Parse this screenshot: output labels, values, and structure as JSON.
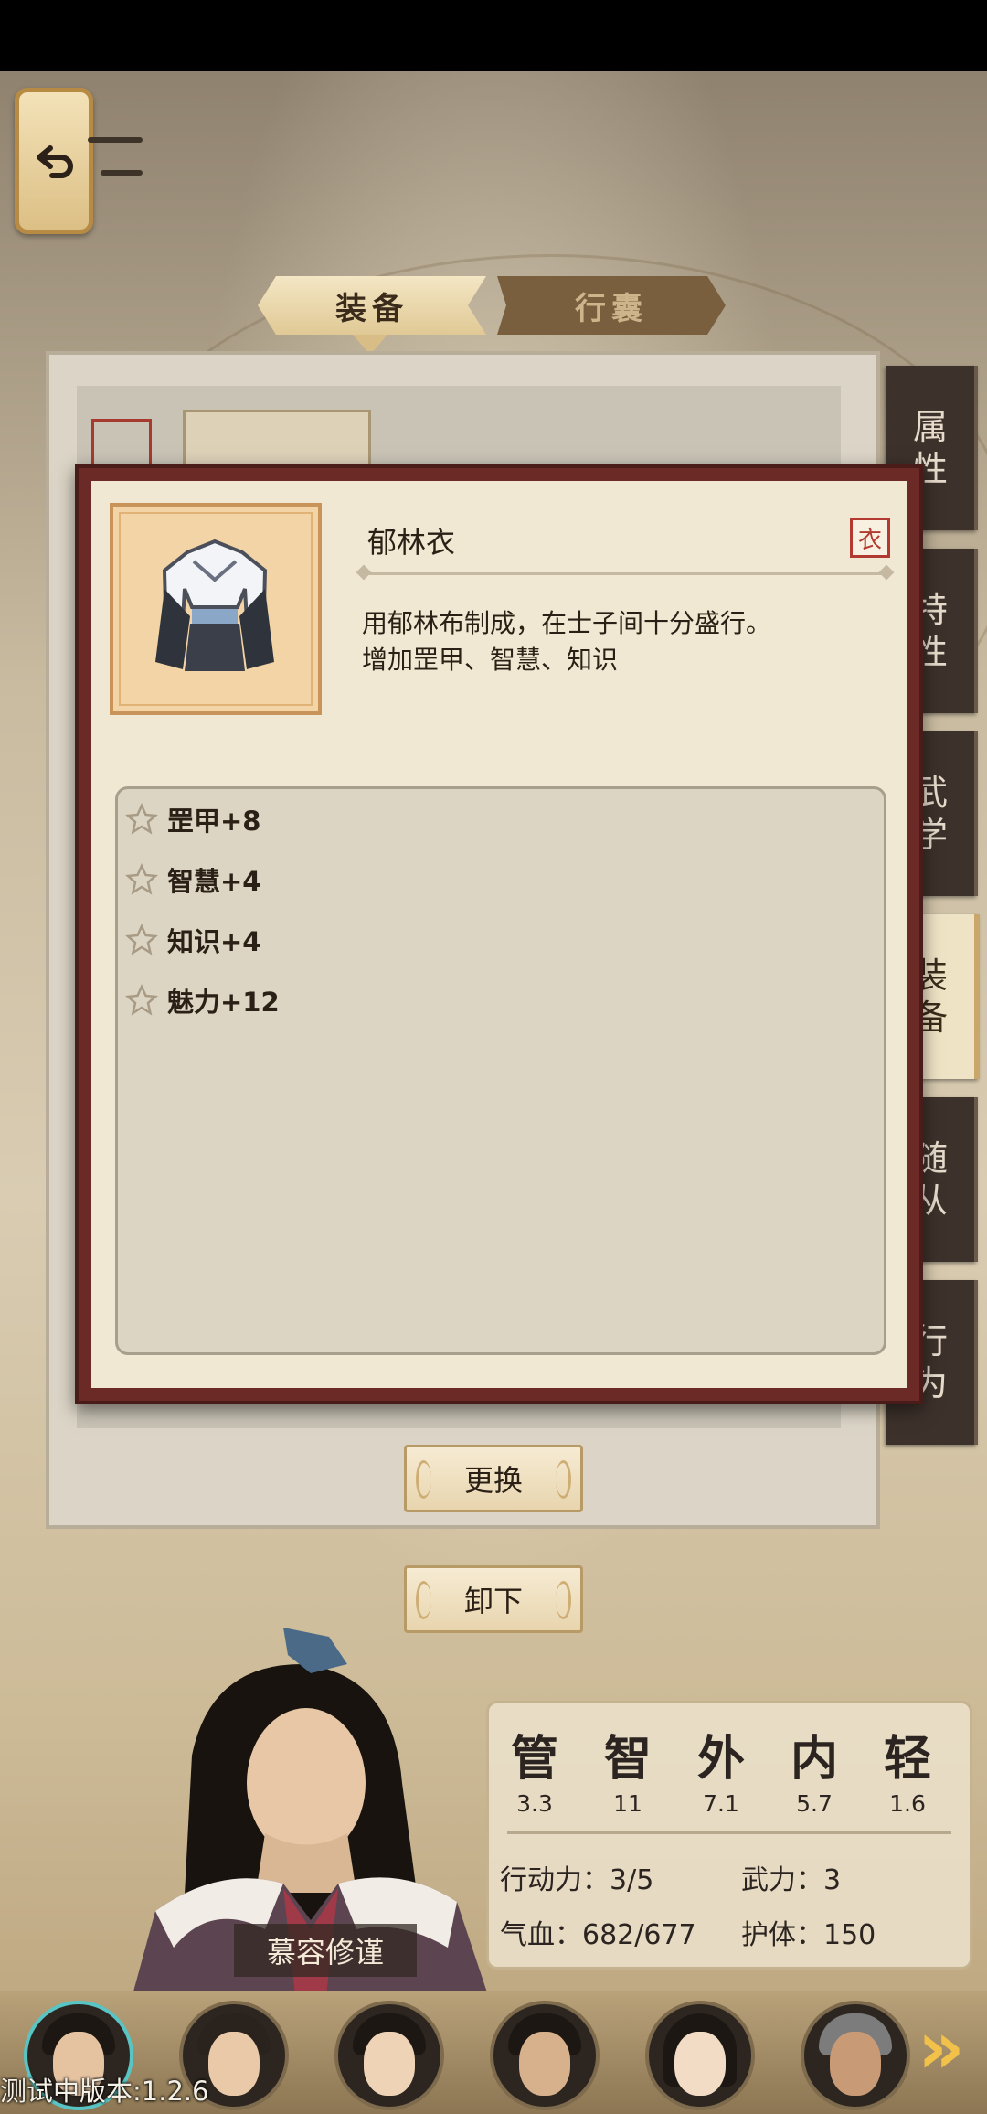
{
  "tabs": {
    "equipment": "装备",
    "bag": "行囊"
  },
  "side_tabs": [
    {
      "label": "属\n性"
    },
    {
      "label": "特\n性"
    },
    {
      "label": "武\n学"
    },
    {
      "label": "装\n备"
    },
    {
      "label": "随\n从"
    },
    {
      "label": "行\n为"
    }
  ],
  "item": {
    "name": "郁林衣",
    "type_badge": "衣",
    "description_line1": "用郁林布制成，在士子间十分盛行。",
    "description_line2": "增加罡甲、智慧、知识",
    "icon": "robe-icon",
    "stats": [
      "罡甲+8",
      "智慧+4",
      "知识+4",
      "魅力+12"
    ]
  },
  "buttons": {
    "replace": "更换",
    "unequip": "卸下"
  },
  "character": {
    "name": "慕容修谨",
    "attributes": [
      {
        "label": "管",
        "value": "3.3"
      },
      {
        "label": "智",
        "value": "11"
      },
      {
        "label": "外",
        "value": "7.1"
      },
      {
        "label": "内",
        "value": "5.7"
      },
      {
        "label": "轻",
        "value": "1.6"
      }
    ],
    "action_power": "行动力：3/5",
    "martial_power": "武力：3",
    "hp": "气血：682/677",
    "guard": "护体：150"
  },
  "version": "测试中版本:1.2.6",
  "colors": {
    "modal_border": "#6b2a26",
    "badge_red": "#b23a30",
    "selected_avatar": "#58c4c4",
    "next_arrow": "#f2c14a"
  }
}
